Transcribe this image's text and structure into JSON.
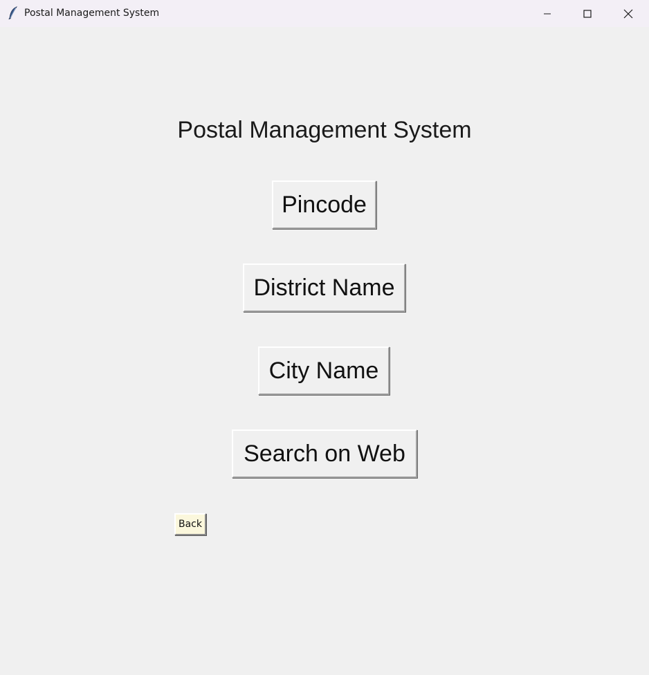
{
  "window": {
    "title": "Postal Management System",
    "icon": "feather-icon",
    "controls": {
      "minimize": "minimize-icon",
      "maximize": "maximize-icon",
      "close": "close-icon"
    }
  },
  "main": {
    "heading": "Postal Management System",
    "buttons": {
      "pincode": "Pincode",
      "district": "District Name",
      "city": "City Name",
      "web": "Search on Web"
    },
    "back_label": "Back"
  },
  "colors": {
    "background": "#f0f0f0",
    "titlebar": "#f3eff6",
    "back_button": "#fbf7dc"
  }
}
